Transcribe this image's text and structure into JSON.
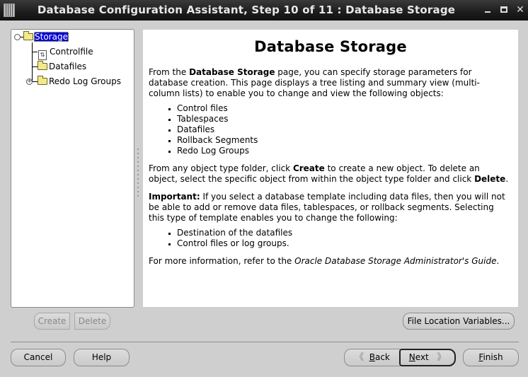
{
  "window": {
    "title": "Database Configuration Assistant, Step 10 of 11 : Database Storage",
    "app_icon": "database-assistant-icon",
    "controls": {
      "minimize": "minimize-icon",
      "maximize": "maximize-icon",
      "close": "close-icon",
      "close_glyph": "✕"
    }
  },
  "tree": {
    "root": {
      "label": "Storage",
      "expanded": true,
      "selected": true,
      "icon": "folder-icon",
      "expander": "⊖"
    },
    "children": [
      {
        "label": "Controlfile",
        "icon": "controlfile-icon",
        "icon_glyph": "⇅"
      },
      {
        "label": "Datafiles",
        "icon": "folder-icon"
      },
      {
        "label": "Redo Log Groups",
        "icon": "folder-icon",
        "expandable": true,
        "expander": "+"
      }
    ],
    "buttons": {
      "create": "Create",
      "delete": "Delete"
    }
  },
  "content": {
    "heading": "Database Storage",
    "p1": {
      "pre": "From the ",
      "bold": "Database Storage",
      "post": " page, you can specify storage parameters for database creation. This page displays a tree listing and summary view (multi-column lists) to enable you to change and view the following objects:"
    },
    "list1": [
      "Control files",
      "Tablespaces",
      "Datafiles",
      "Rollback Segments",
      "Redo Log Groups"
    ],
    "p2": {
      "pre": "From any object type folder, click ",
      "bold1": "Create",
      "mid": " to create a new object. To delete an object, select the specific object from within the object type folder and click ",
      "bold2": "Delete",
      "post": "."
    },
    "p3": {
      "bold": "Important:",
      "post": " If you select a database template including data files, then you will not be able to add or remove data files, tablespaces, or rollback segments. Selecting this type of template enables you to change the following:"
    },
    "list2": [
      "Destination of the datafiles",
      "Control files or log groups."
    ],
    "p4": {
      "pre": "For more information, refer to the ",
      "italic": "Oracle Database Storage Administrator's Guide",
      "post": "."
    }
  },
  "buttons": {
    "file_location": "File Location Variables...",
    "cancel": "Cancel",
    "help": "Help",
    "back_arrow": "《",
    "back_mnemonic": "B",
    "back_rest": "ack",
    "next_mnemonic": "N",
    "next_rest": "ext",
    "next_arrow": "》",
    "finish_mnemonic": "F",
    "finish_rest": "inish"
  }
}
